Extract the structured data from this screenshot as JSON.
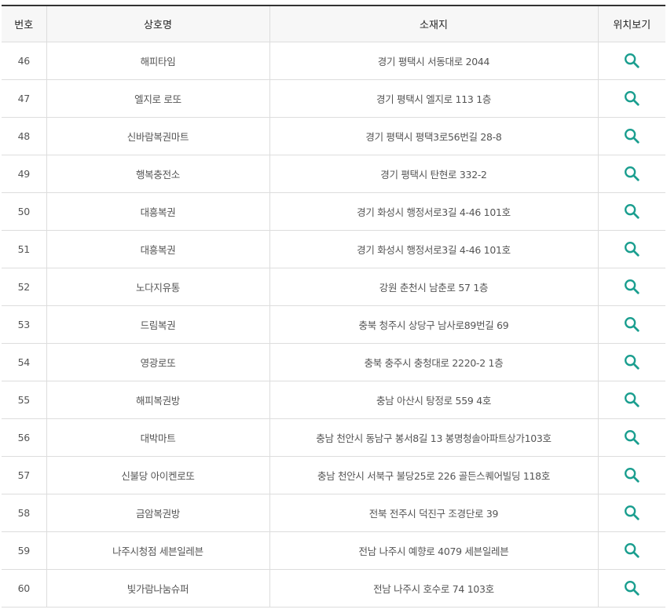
{
  "table": {
    "headers": {
      "no": "번호",
      "name": "상호명",
      "address": "소재지",
      "location": "위치보기"
    },
    "accent_color": "#1a9e8f",
    "rows": [
      {
        "no": "46",
        "name": "해피타임",
        "address": "경기 평택시 서동대로 2044",
        "icon": "search-icon"
      },
      {
        "no": "47",
        "name": "엘지로 로또",
        "address": "경기 평택시 엘지로 113 1층",
        "icon": "search-icon"
      },
      {
        "no": "48",
        "name": "신바람복권마트",
        "address": "경기 평택시 평택3로56번길 28-8",
        "icon": "search-icon"
      },
      {
        "no": "49",
        "name": "행복충전소",
        "address": "경기 평택시 탄현로 332-2",
        "icon": "search-icon"
      },
      {
        "no": "50",
        "name": "대흥복권",
        "address": "경기 화성시 행정서로3길 4-46 101호",
        "icon": "search-icon"
      },
      {
        "no": "51",
        "name": "대흥복권",
        "address": "경기 화성시 행정서로3길 4-46 101호",
        "icon": "search-icon"
      },
      {
        "no": "52",
        "name": "노다지유통",
        "address": "강원 춘천시 남춘로 57 1층",
        "icon": "search-icon"
      },
      {
        "no": "53",
        "name": "드림복권",
        "address": "충북 청주시 상당구 남사로89번길 69",
        "icon": "search-icon"
      },
      {
        "no": "54",
        "name": "영광로또",
        "address": "충북 충주시 충청대로 2220-2 1층",
        "icon": "search-icon"
      },
      {
        "no": "55",
        "name": "해피복권방",
        "address": "충남 아산시 탕정로 559 4호",
        "icon": "search-icon"
      },
      {
        "no": "56",
        "name": "대박마트",
        "address": "충남 천안시 동남구 봉서8길 13 봉명청솔아파트상가103호",
        "icon": "search-icon"
      },
      {
        "no": "57",
        "name": "신불당 아이켄로또",
        "address": "충남 천안시 서북구 불당25로 226 골든스퀘어빌딩 118호",
        "icon": "search-icon"
      },
      {
        "no": "58",
        "name": "금암복권방",
        "address": "전북 전주시 덕진구 조경단로 39",
        "icon": "search-icon"
      },
      {
        "no": "59",
        "name": "나주시청점 세븐일레븐",
        "address": "전남 나주시 예향로 4079 세븐일레븐",
        "icon": "search-icon"
      },
      {
        "no": "60",
        "name": "빛가람나눔슈퍼",
        "address": "전남 나주시 호수로 74 103호",
        "icon": "search-icon"
      }
    ]
  }
}
